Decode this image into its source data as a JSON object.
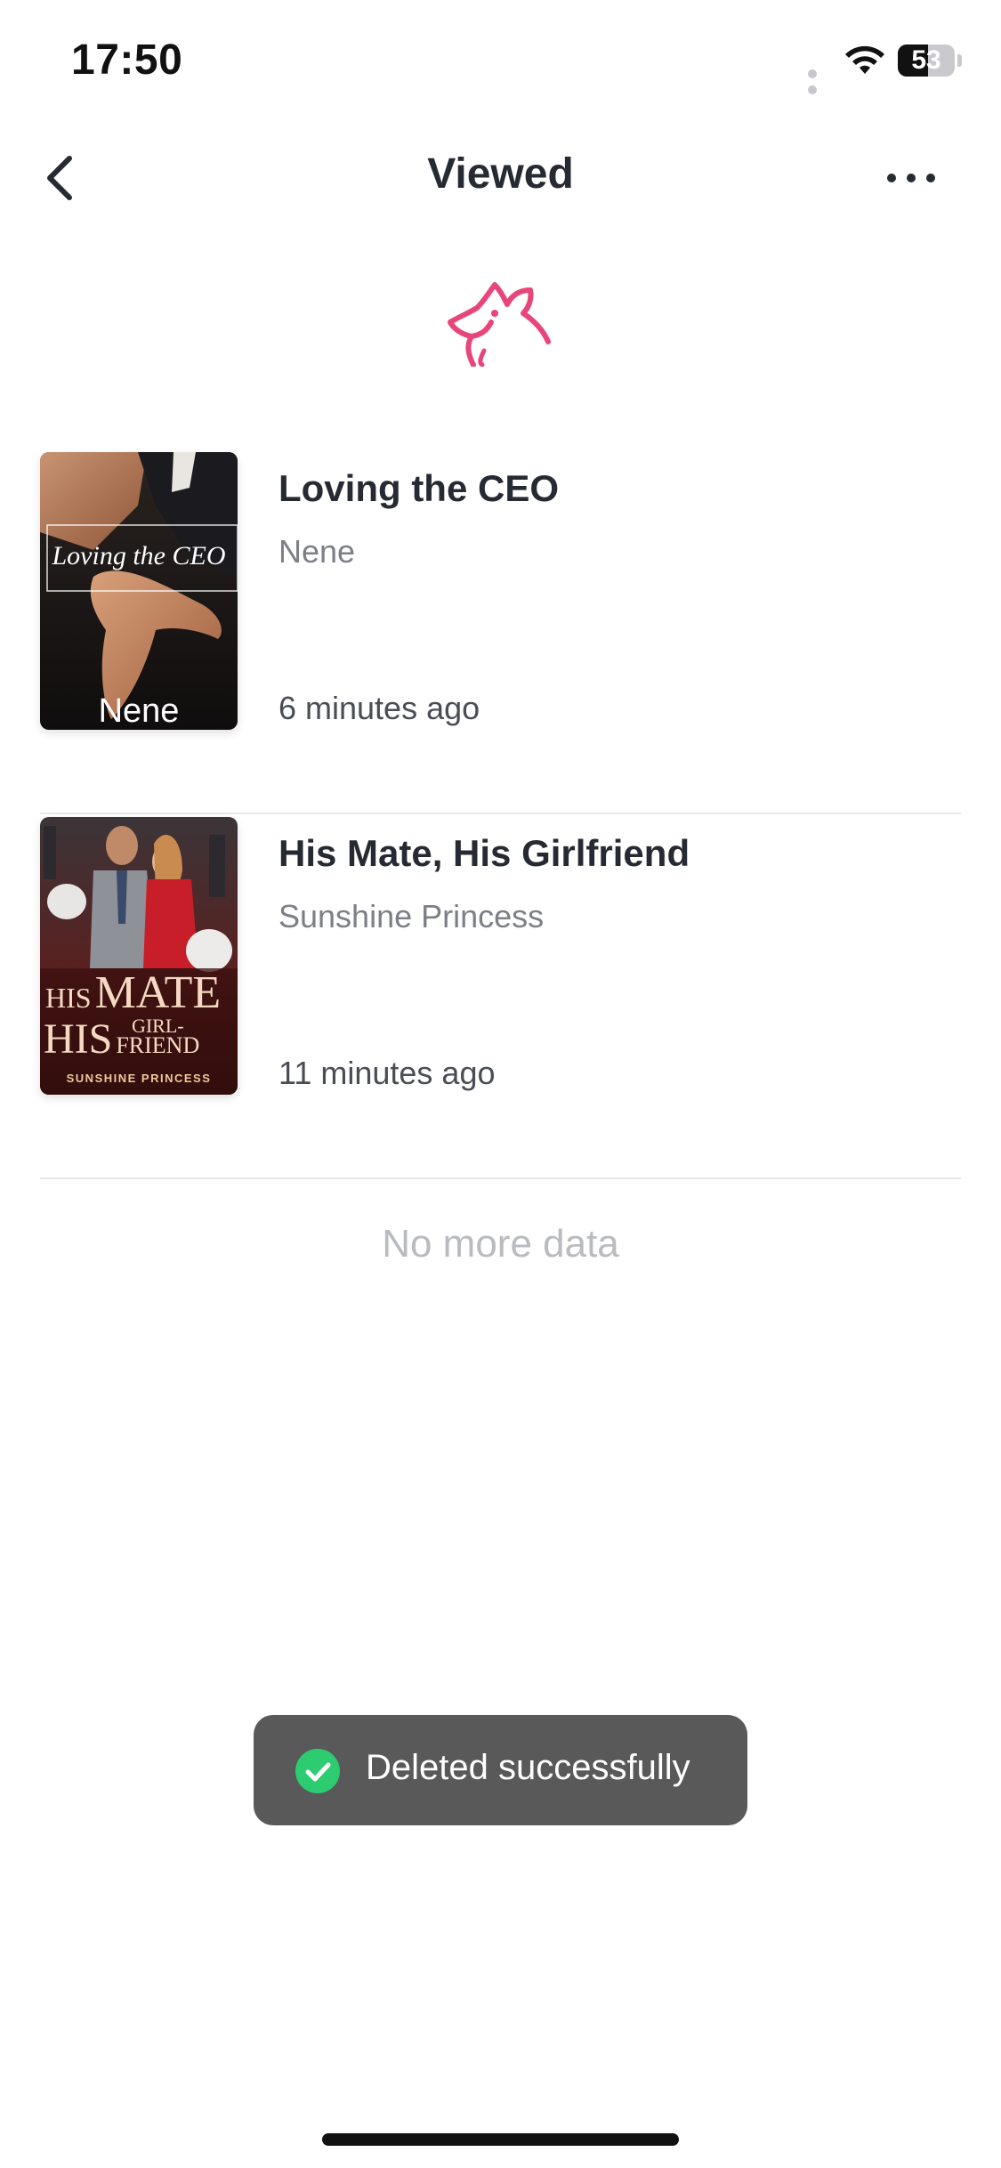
{
  "status_bar": {
    "time": "17:50",
    "battery_level": 53,
    "battery_text": "53"
  },
  "nav": {
    "title": "Viewed",
    "back_icon": "chevron-left-icon",
    "more_icon": "ellipsis-icon"
  },
  "logo": {
    "icon": "wolf-head-logo",
    "color": "#e8457a"
  },
  "books": [
    {
      "title": "Loving the CEO",
      "author": "Nene",
      "time": "6 minutes ago",
      "cover": {
        "title_text": "Loving the CEO",
        "author_text": "Nene"
      }
    },
    {
      "title": "His Mate, His Girlfriend",
      "author": "Sunshine Princess",
      "time": "11 minutes ago",
      "cover": {
        "line1_a": "HIS",
        "line1_b": "MATE",
        "line2_a": "HIS",
        "line2_b": "GIRL-",
        "line2_c": "FRIEND",
        "author_text": "SUNSHINE PRINCESS"
      }
    }
  ],
  "footer_text": "No more data",
  "toast": {
    "icon": "check-circle-icon",
    "message": "Deleted successfully",
    "icon_color": "#2ecc71"
  }
}
